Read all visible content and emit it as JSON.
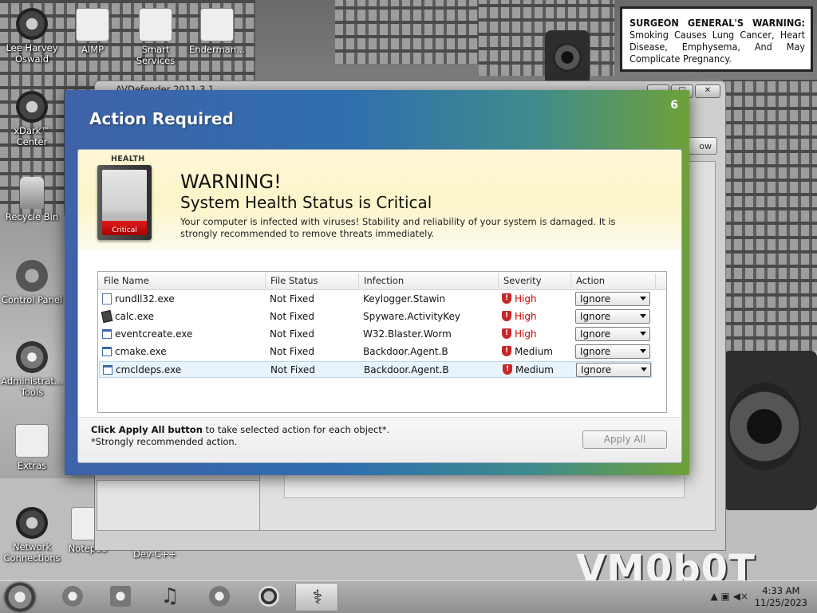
{
  "desktop": {
    "icons": [
      {
        "label": "Lee Harvey Oswald"
      },
      {
        "label": "AIMP"
      },
      {
        "label": "Smart Services"
      },
      {
        "label": "Enderman..."
      },
      {
        "label": "xDark™ Center"
      },
      {
        "label": "Recycle Bin"
      },
      {
        "label": "Control Panel"
      },
      {
        "label": "Administrat... Tools"
      },
      {
        "label": "Extras"
      },
      {
        "label": "Network Connections"
      },
      {
        "label": "Notepad"
      },
      {
        "label": "Embarcadero Dev-C++"
      }
    ],
    "warning_sign": {
      "heading": "SURGEON GENERAL'S WARNING:",
      "body": "Smoking Causes Lung Cancer, Heart Disease, Emphysema, And May Complicate Pregnancy."
    },
    "watermark": "VM0b0T"
  },
  "background_window": {
    "title": "AVDefender 2011 3.1",
    "ghost_button": "ow"
  },
  "dialog": {
    "title": "Action Required",
    "counter": "6",
    "health": {
      "label": "HEALTH",
      "state": "Critical",
      "level_percent": 22
    },
    "heading": "WARNING!",
    "subheading": "System Health Status is Critical",
    "message": "Your computer is infected with viruses! Stability and reliability of your system is damaged. It is strongly recommended to remove threats immediately.",
    "table": {
      "columns": [
        "File Name",
        "File Status",
        "Infection",
        "Severity",
        "Action"
      ],
      "rows": [
        {
          "file": "rundll32.exe",
          "status": "Not Fixed",
          "infection": "Keylogger.Stawin",
          "severity": "High",
          "action": "Ignore"
        },
        {
          "file": "calc.exe",
          "status": "Not Fixed",
          "infection": "Spyware.ActivityKey",
          "severity": "High",
          "action": "Ignore"
        },
        {
          "file": "eventcreate.exe",
          "status": "Not Fixed",
          "infection": "W32.Blaster.Worm",
          "severity": "High",
          "action": "Ignore"
        },
        {
          "file": "cmake.exe",
          "status": "Not Fixed",
          "infection": "Backdoor.Agent.B",
          "severity": "Medium",
          "action": "Ignore"
        },
        {
          "file": "cmcldeps.exe",
          "status": "Not Fixed",
          "infection": "Backdoor.Agent.B",
          "severity": "Medium",
          "action": "Ignore"
        }
      ]
    },
    "footer_bold": "Click Apply All button",
    "footer_rest": " to take selected action for each object*.",
    "footer_note": "*Strongly recommended action.",
    "apply_all": "Apply All"
  },
  "taskbar": {
    "time": "4:33 AM",
    "date": "11/25/2023",
    "tray_symbols": "▲ ▣ ◀×"
  },
  "colors": {
    "dialog_gradient_start": "#3f62a8",
    "dialog_gradient_end": "#6ea13a",
    "severity_high": "#d00000",
    "health_fill": "#e11c1c"
  }
}
